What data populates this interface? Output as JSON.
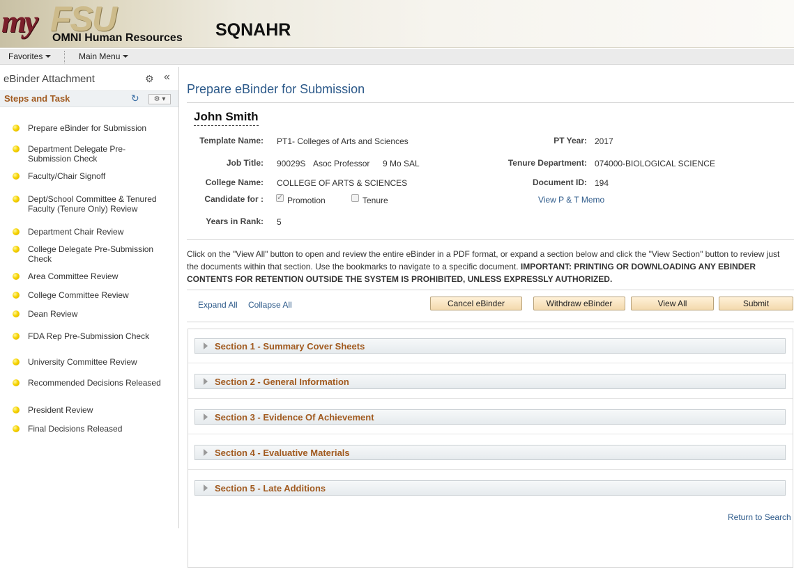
{
  "header": {
    "logo_my": "my",
    "logo_fsu": "FSU",
    "logo_subtitle": "OMNI Human Resources",
    "environment": "SQNAHR"
  },
  "nav": {
    "favorites": "Favorites",
    "main_menu": "Main Menu"
  },
  "left_panel": {
    "title": "eBinder Attachment",
    "steps_title": "Steps and Task",
    "steps": [
      "Prepare eBinder for Submission",
      "Department Delegate Pre-Submission Check",
      "Faculty/Chair Signoff",
      "Dept/School Committee & Tenured Faculty (Tenure Only) Review",
      "Department Chair Review",
      "College Delegate Pre-Submission Check",
      "Area Committee Review",
      "College Committee Review",
      "Dean Review",
      "FDA Rep Pre-Submission Check",
      "University Committee Review",
      "Recommended Decisions Released",
      "President Review",
      "Final Decisions Released"
    ]
  },
  "main": {
    "page_title": "Prepare eBinder for Submission",
    "person_name": "John Smith",
    "labels": {
      "template_name": "Template Name:",
      "job_title": "Job Title:",
      "college_name": "College Name:",
      "candidate_for": "Candidate for :",
      "years_in_rank": "Years in Rank:",
      "pt_year": "PT Year:",
      "tenure_department": "Tenure Department:",
      "document_id": "Document ID:"
    },
    "values": {
      "template_name": "PT1- Colleges of Arts and Sciences",
      "job_code": "90029S",
      "job_title": "Asoc Professor",
      "job_term": "9 Mo SAL",
      "college_name": "COLLEGE OF ARTS & SCIENCES",
      "promotion_label": "Promotion",
      "promotion_checked": true,
      "tenure_label": "Tenure",
      "tenure_checked": false,
      "years_in_rank": "5",
      "pt_year": "2017",
      "tenure_department": "074000-BIOLOGICAL SCIENCE",
      "document_id": "194",
      "memo_link": "View P & T Memo"
    },
    "notice_text": "Click on the \"View All\" button to open and review the entire eBinder in a PDF format, or expand a section below and click the \"View Section\" button to review just the documents within that section. Use the bookmarks to navigate to a specific document. ",
    "notice_bold": "IMPORTANT: PRINTING OR DOWNLOADING ANY EBINDER CONTENTS FOR RETENTION OUTSIDE THE SYSTEM IS PROHIBITED, UNLESS EXPRESSLY AUTHORIZED.",
    "expand_all": "Expand All",
    "collapse_all": "Collapse All",
    "buttons": {
      "cancel": "Cancel eBinder",
      "withdraw": "Withdraw eBinder",
      "view_all": "View All",
      "submit": "Submit"
    },
    "sections": [
      "Section 1 - Summary Cover Sheets",
      "Section 2 - General Information",
      "Section 3 - Evidence Of Achievement",
      "Section 4 - Evaluative Materials",
      "Section 5 - Late Additions"
    ],
    "return_link": "Return to Search"
  }
}
